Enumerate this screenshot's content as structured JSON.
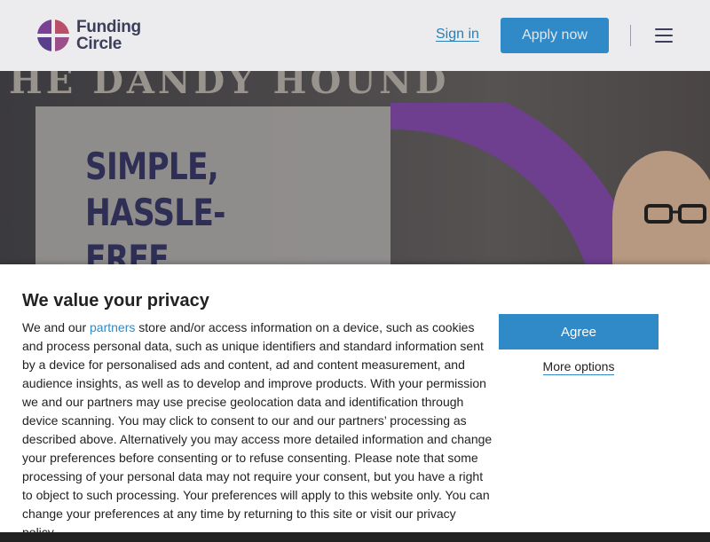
{
  "header": {
    "logo_line1": "Funding",
    "logo_line2": "Circle",
    "signin_label": "Sign in",
    "apply_label": "Apply now",
    "menu_icon": "hamburger-menu-icon"
  },
  "hero": {
    "background_sign_text": "HE DANDY HOUND",
    "title": "SIMPLE, HASSLE-\nFREE BUSINESS\nFINANCE"
  },
  "consent": {
    "title": "We value your privacy",
    "text_before_link": "We and our ",
    "link_text": "partners",
    "text_after_link": " store and/or access information on a device, such as cookies and process personal data, such as unique identifiers and standard information sent by a device for personalised ads and content, ad and content measurement, and audience insights, as well as to develop and improve products. With your permission we and our partners may use precise geolocation data and identification through device scanning. You may click to consent to our and our partners’ processing as described above. Alternatively you may access more detailed information and change your preferences before consenting or to refuse consenting. Please note that some processing of your personal data may not require your consent, but you have a right to object to such processing. Your preferences will apply to this website only. You can change your preferences at any time by returning to this site or visit our privacy policy.",
    "agree_label": "Agree",
    "more_options_label": "More options"
  },
  "colors": {
    "brand_navy": "#3d3e5c",
    "brand_blue": "#2f8ac7",
    "brand_purple": "#7b3f95"
  }
}
